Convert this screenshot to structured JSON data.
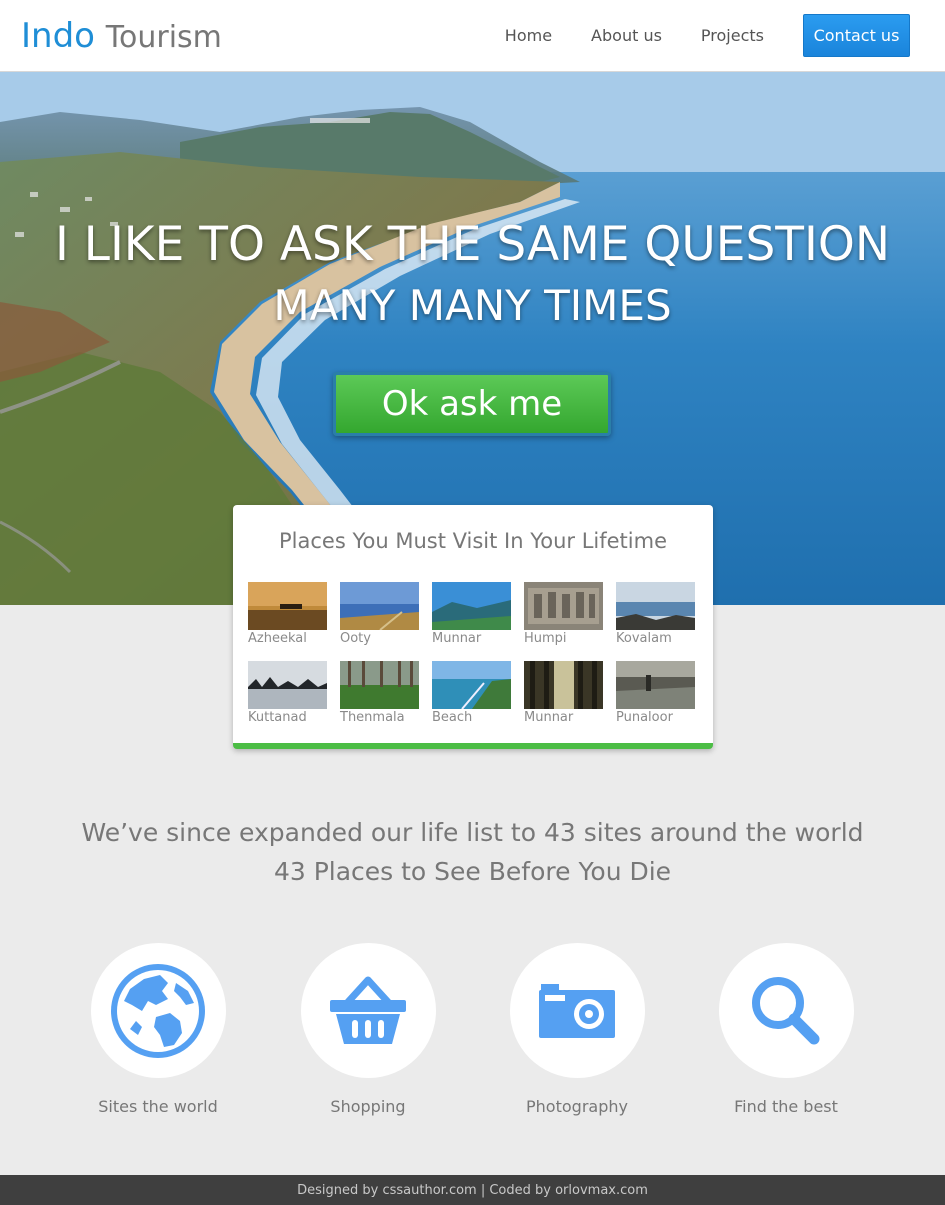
{
  "header": {
    "logo_brand": "Indo",
    "logo_rest": "Tourism",
    "nav": [
      "Home",
      "About us",
      "Projects"
    ],
    "cta": "Contact us"
  },
  "hero": {
    "title": "I LIKE TO ASK THE SAME QUESTION",
    "subtitle": "MANY MANY TIMES",
    "button": "Ok ask me"
  },
  "places": {
    "title": "Places You Must Visit In Your Lifetime",
    "items": [
      "Azheekal",
      "Ooty",
      "Munnar",
      "Humpi",
      "Kovalam",
      "Kuttanad",
      "Thenmala",
      "Beach",
      "Munnar",
      "Punaloor"
    ]
  },
  "tagline": {
    "line1": "We’ve since expanded our life list to 43 sites around the world",
    "line2": "43 Places to See Before You Die"
  },
  "features": [
    {
      "label": "Sites the world",
      "icon": "globe-icon"
    },
    {
      "label": "Shopping",
      "icon": "basket-icon"
    },
    {
      "label": "Photography",
      "icon": "camera-icon"
    },
    {
      "label": "Find the best",
      "icon": "search-icon"
    }
  ],
  "footer": {
    "text": "Designed by cssauthor.com | Coded by orlovmax.com"
  },
  "colors": {
    "brand": "#1f8ed6",
    "cta": "#2b9cf0",
    "green": "#4cbd45",
    "icon": "#55a0f2"
  }
}
